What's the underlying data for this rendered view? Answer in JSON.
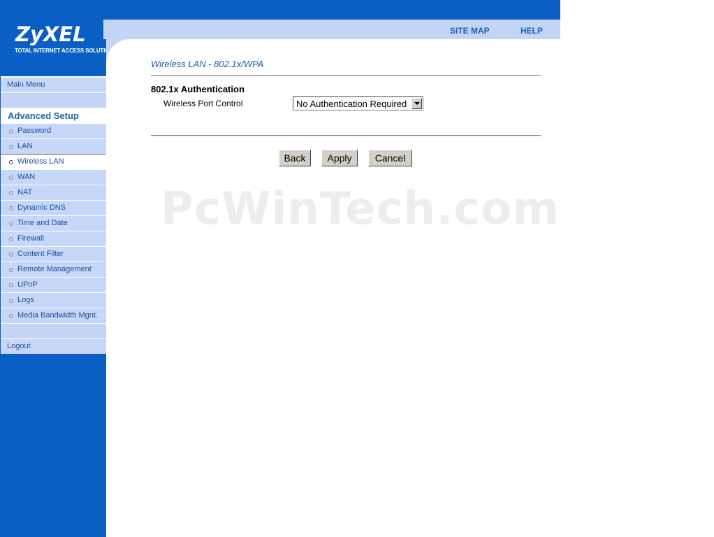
{
  "brand": {
    "name": "ZyXEL",
    "tagline": "TOTAL INTERNET ACCESS SOLUTION"
  },
  "header": {
    "site_map": "SITE MAP",
    "help": "HELP"
  },
  "sidebar": {
    "main_menu": "Main Menu",
    "advanced_setup": "Advanced Setup",
    "items": [
      {
        "label": "Password"
      },
      {
        "label": "LAN"
      },
      {
        "label": "Wireless LAN"
      },
      {
        "label": "WAN"
      },
      {
        "label": "NAT"
      },
      {
        "label": "Dynamic DNS"
      },
      {
        "label": "Time and Date"
      },
      {
        "label": "Firewall"
      },
      {
        "label": "Content Filter"
      },
      {
        "label": "Remote Management"
      },
      {
        "label": "UPnP"
      },
      {
        "label": "Logs"
      },
      {
        "label": "Media Bandwidth Mgnt."
      }
    ],
    "logout": "Logout"
  },
  "main": {
    "title": "Wireless LAN - 802.1x/WPA",
    "section": "802.1x Authentication",
    "port_control_label": "Wireless Port Control",
    "port_control_value": "No Authentication Required",
    "buttons": {
      "back": "Back",
      "apply": "Apply",
      "cancel": "Cancel"
    }
  },
  "watermark": "PcWinTech.com",
  "colors": {
    "sidebar_blue": "#0a5fc4",
    "nav_light": "#c7d7f7",
    "link_blue": "#1a5fb4"
  }
}
